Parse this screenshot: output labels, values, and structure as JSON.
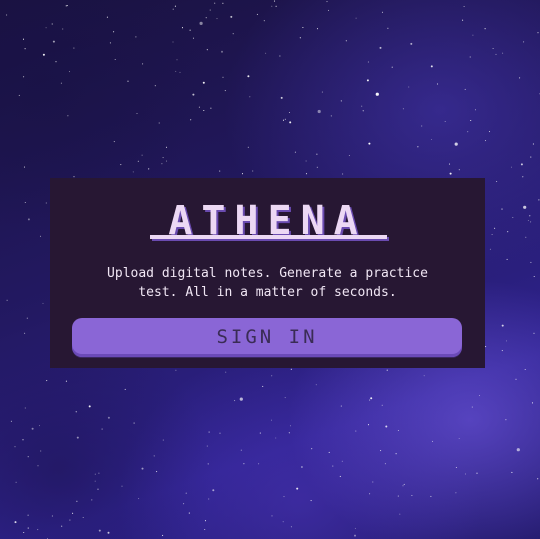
{
  "app": {
    "title": "ATHENA",
    "tagline": "Upload digital notes. Generate a practice\ntest. All in a matter of seconds.",
    "sign_in_label": "SIGN IN"
  },
  "colors": {
    "background": "#231963",
    "card": "#271733",
    "title": "#ecd8f4",
    "button": "#8a66d6",
    "button_text": "#3a2c55"
  }
}
